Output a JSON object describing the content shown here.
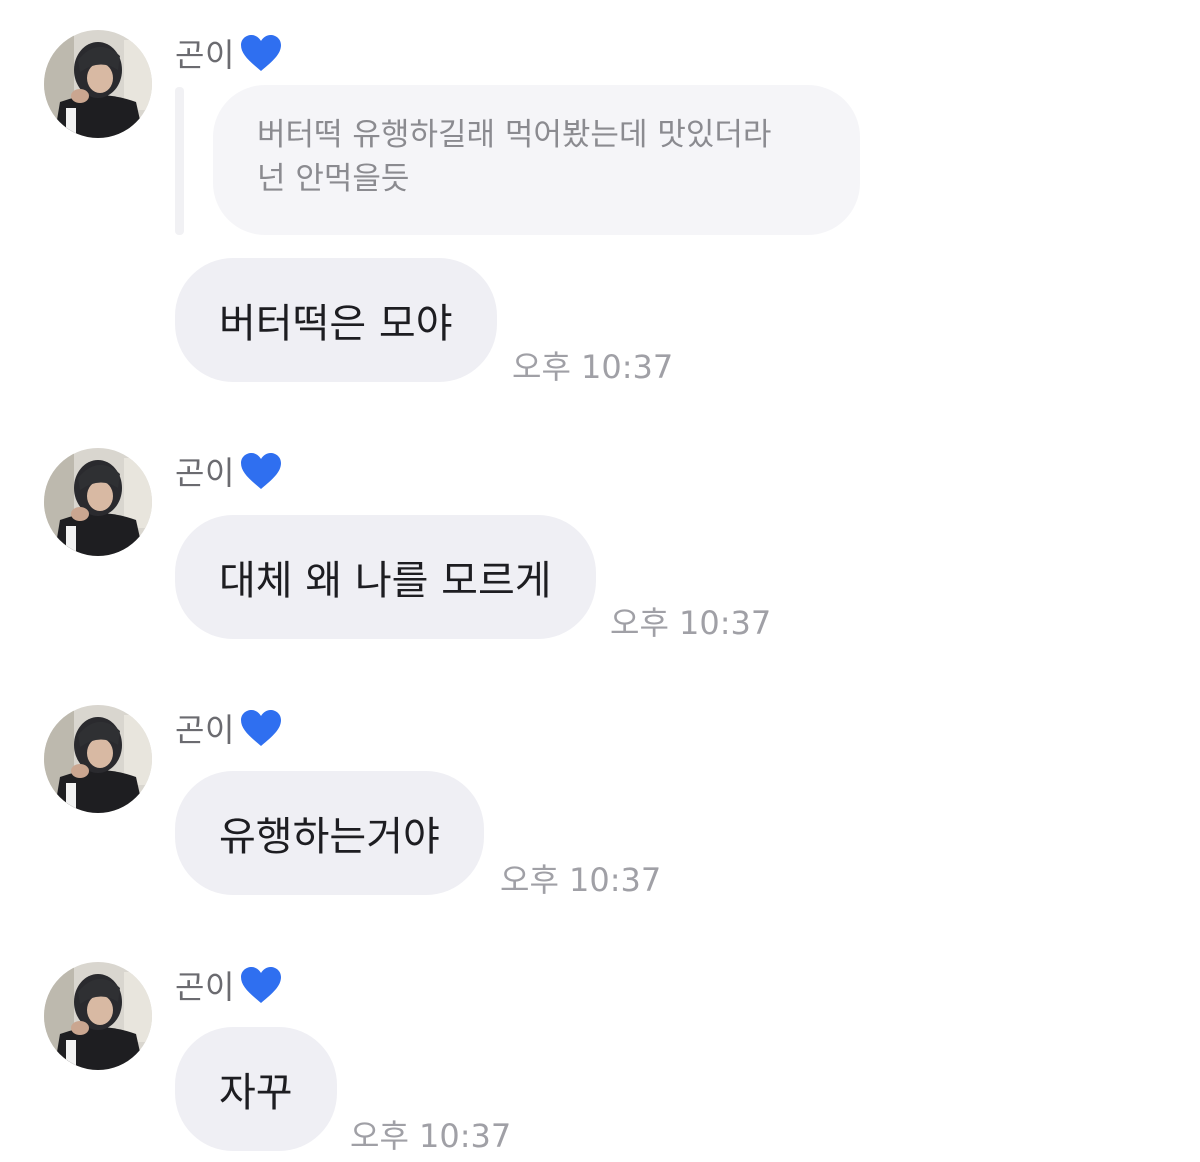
{
  "messages": [
    {
      "sender": "곤이",
      "heart": "blue-heart",
      "reply_quote": [
        "버터떡 유행하길래 먹어봤는데 맛있더라",
        "넌 안먹을듯"
      ],
      "text": "버터떡은 모야",
      "time": "오후 10:37"
    },
    {
      "sender": "곤이",
      "heart": "blue-heart",
      "text": "대체 왜 나를 모르게",
      "time": "오후 10:37"
    },
    {
      "sender": "곤이",
      "heart": "blue-heart",
      "text": "유행하는거야",
      "time": "오후 10:37"
    },
    {
      "sender": "곤이",
      "heart": "blue-heart",
      "text": "자꾸",
      "time": "오후 10:37"
    }
  ],
  "colors": {
    "bubble": "#efeff4",
    "reply_bubble": "#f5f5f8",
    "heart": "#2f6ff0",
    "time": "#a0a0a6"
  }
}
